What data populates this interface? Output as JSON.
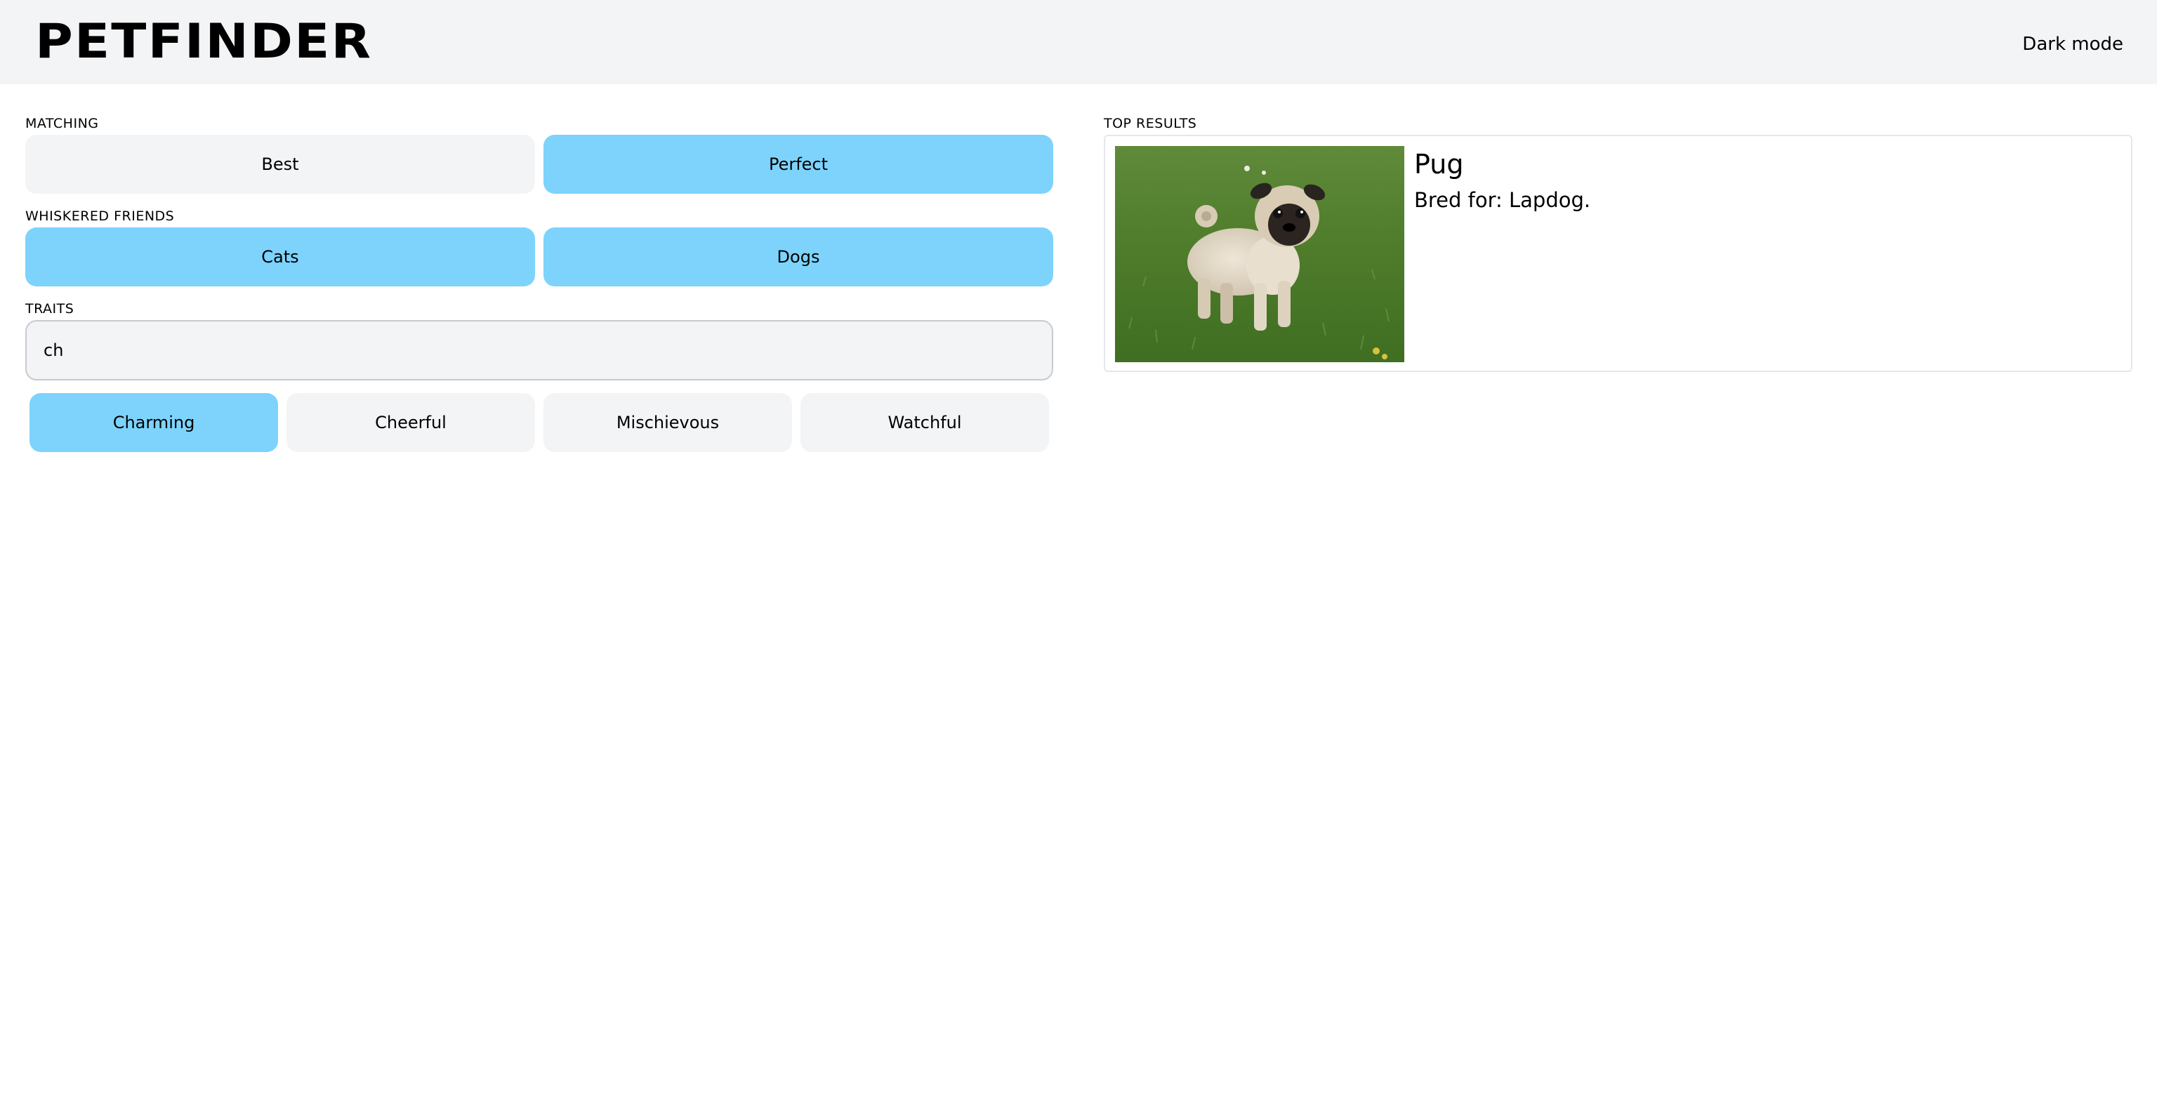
{
  "header": {
    "logo": "PETFINDER",
    "dark_mode_label": "Dark mode"
  },
  "matching": {
    "label": "MATCHING",
    "options": [
      {
        "label": "Best",
        "selected": false
      },
      {
        "label": "Perfect",
        "selected": true
      }
    ]
  },
  "whiskered_friends": {
    "label": "WHISKERED FRIENDS",
    "options": [
      {
        "label": "Cats",
        "selected": true
      },
      {
        "label": "Dogs",
        "selected": true
      }
    ]
  },
  "traits": {
    "label": "TRAITS",
    "input_value": "ch",
    "suggestions": [
      {
        "label": "Charming",
        "selected": true
      },
      {
        "label": "Cheerful",
        "selected": false
      },
      {
        "label": "Mischievous",
        "selected": false
      },
      {
        "label": "Watchful",
        "selected": false
      }
    ]
  },
  "top_results": {
    "label": "TOP RESULTS",
    "items": [
      {
        "name": "Pug",
        "bred_for": "Bred for: Lapdog.",
        "image_icon": "pug-photo"
      }
    ]
  },
  "colors": {
    "selected": "#7dd3fc",
    "unselected": "#f3f4f6",
    "header_bg": "#f3f4f6"
  }
}
